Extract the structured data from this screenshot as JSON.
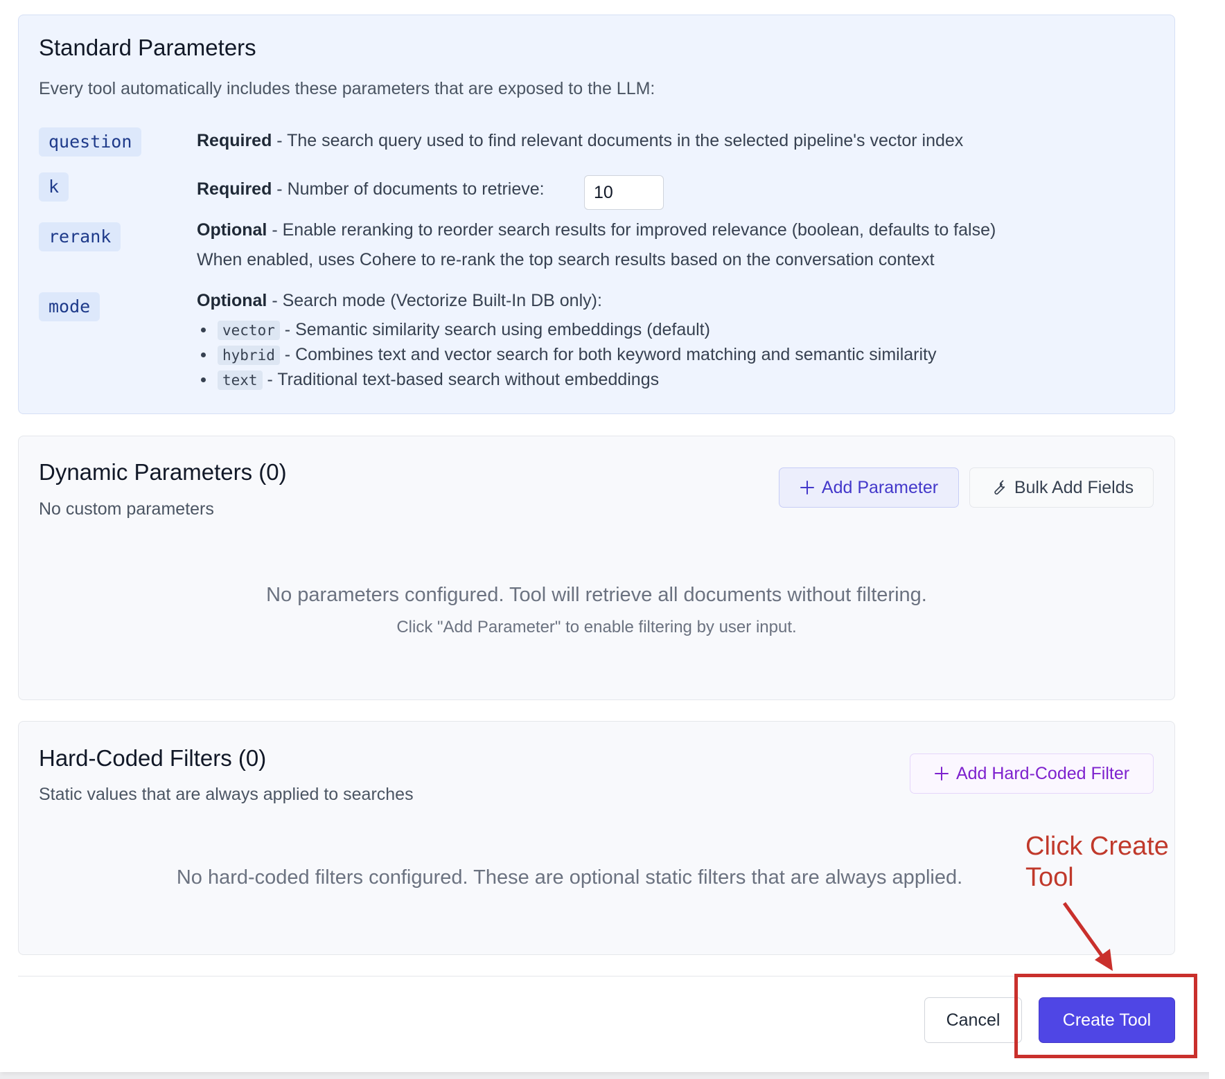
{
  "standard": {
    "title": "Standard Parameters",
    "intro": "Every tool automatically includes these parameters that are exposed to the LLM:",
    "params": [
      {
        "name": "question",
        "req": "Required",
        "desc": " - The search query used to find relevant documents in the selected pipeline's vector index"
      },
      {
        "name": "k",
        "req": "Required",
        "desc": " - Number of documents to retrieve:",
        "input_value": "10"
      },
      {
        "name": "rerank",
        "req": "Optional",
        "desc": " - Enable reranking to reorder search results for improved relevance (boolean, defaults to false)",
        "note": "When enabled, uses Cohere to re-rank the top search results based on the conversation context"
      },
      {
        "name": "mode",
        "req": "Optional",
        "desc": " - Search mode (Vectorize Built-In DB only):",
        "options": [
          {
            "code": "vector",
            "text": " - Semantic similarity search using embeddings (default)"
          },
          {
            "code": "hybrid",
            "text": " - Combines text and vector search for both keyword matching and semantic similarity"
          },
          {
            "code": "text",
            "text": " - Traditional text-based search without embeddings"
          }
        ]
      }
    ]
  },
  "dynamic": {
    "title": "Dynamic Parameters (0)",
    "subtitle": "No custom parameters",
    "add_button": "Add Parameter",
    "bulk_button": "Bulk Add Fields",
    "empty_main": "No parameters configured. Tool will retrieve all documents without filtering.",
    "empty_sub": "Click \"Add Parameter\" to enable filtering by user input."
  },
  "hardcoded": {
    "title": "Hard-Coded Filters (0)",
    "subtitle": "Static values that are always applied to searches",
    "add_button": "Add Hard-Coded Filter",
    "empty_main": "No hard-coded filters configured. These are optional static filters that are always applied."
  },
  "footer": {
    "cancel": "Cancel",
    "create": "Create Tool"
  },
  "annotation": {
    "text": "Click Create Tool",
    "color": "#c9302c"
  },
  "colors": {
    "primary": "#4f46e5",
    "purple": "#7e22ce",
    "standard_bg": "#eff4fe"
  }
}
